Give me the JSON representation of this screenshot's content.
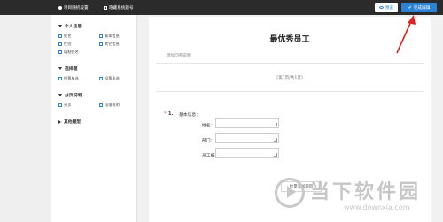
{
  "topbar": {
    "items": [
      "项目随机设置",
      "隐藏系统题号"
    ],
    "preview_label": "预览",
    "done_label": "完成编辑"
  },
  "sidebar": {
    "sections": [
      {
        "title": "个人信息"
      },
      {
        "title": "选择题"
      },
      {
        "title": "分页说明"
      },
      {
        "title": "其他题型"
      }
    ],
    "personal": [
      "姓名",
      "基本信息",
      "性别",
      "其它信息",
      "填制签名"
    ],
    "choice": [
      "投票单选",
      "投票多选"
    ],
    "paging": [
      "分页",
      "段落说明"
    ]
  },
  "survey": {
    "title": "最优秀员工",
    "add_desc": "添加问卷说明",
    "page_indicator": "[第1页/共1页]",
    "question": {
      "required_mark": "*",
      "number": "1.",
      "title": "基本信息：",
      "fields": [
        "姓名：",
        "部门：",
        "员工编号："
      ]
    },
    "batch_add": "批量添加题目"
  },
  "watermark": {
    "text": "当下软件园",
    "url": "www.downxia.com"
  },
  "colors": {
    "accent": "#2a83d7",
    "topbar": "#2b2b2b",
    "annotation": "#e02020"
  }
}
